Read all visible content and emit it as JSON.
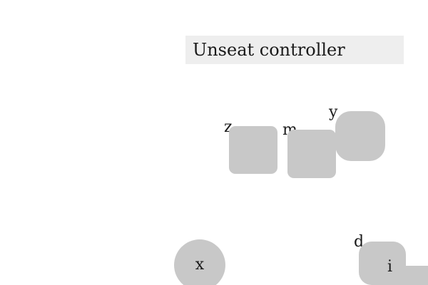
{
  "instruction": {
    "text": "Unseat controller"
  },
  "shapes": {
    "z": {
      "label": "z",
      "kind": "rounded-square"
    },
    "m": {
      "label": "m",
      "kind": "rounded-square"
    },
    "y": {
      "label": "y",
      "kind": "rounded-square"
    },
    "x": {
      "label": "x",
      "kind": "circle"
    },
    "d": {
      "label": "d",
      "kind": "rounded-square"
    },
    "i": {
      "label": "i",
      "kind": "rounded-square"
    }
  },
  "colors": {
    "shape_fill": "#c8c8c8",
    "instruction_bg": "#eeeeee",
    "text": "#1a1a1a",
    "background": "#ffffff"
  }
}
